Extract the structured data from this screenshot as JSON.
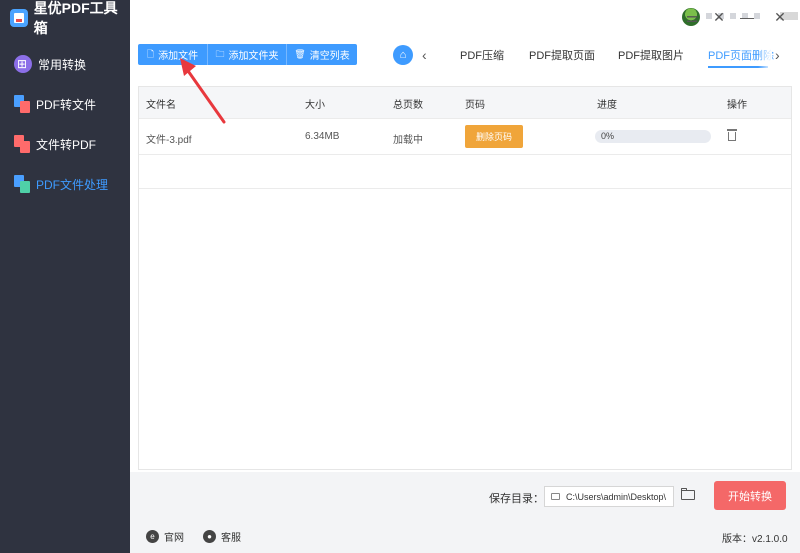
{
  "app": {
    "title": "星优PDF工具箱"
  },
  "sidebar": {
    "items": [
      {
        "label": "常用转换",
        "icon": "grid-icon",
        "active": false
      },
      {
        "label": "PDF转文件",
        "icon": "pdf-to-file-icon",
        "active": false
      },
      {
        "label": "文件转PDF",
        "icon": "file-to-pdf-icon",
        "active": false
      },
      {
        "label": "PDF文件处理",
        "icon": "pdf-process-icon",
        "active": true
      }
    ]
  },
  "titlebar": {
    "controls": [
      "settings-icon",
      "close-x-icon",
      "minimize-icon",
      "maximize-icon",
      "close-icon"
    ]
  },
  "toolbar": {
    "add_file": "添加文件",
    "add_folder": "添加文件夹",
    "clear_list": "清空列表"
  },
  "tabs": {
    "items": [
      "PDF压缩",
      "PDF提取页面",
      "PDF提取图片",
      "PDF页面删除"
    ],
    "active_index": 3
  },
  "table": {
    "headers": [
      "文件名",
      "大小",
      "总页数",
      "页码",
      "进度",
      "操作"
    ],
    "rows": [
      {
        "filename": "文件-3.pdf",
        "size": "6.34MB",
        "pages": "加载中",
        "action_label": "删除页码",
        "progress_text": "0%",
        "progress": 0
      }
    ]
  },
  "output": {
    "label": "保存目录：",
    "path": "C:\\Users\\admin\\Desktop\\",
    "start_label": "开始转换"
  },
  "footer": {
    "website": "官网",
    "support": "客服",
    "version": "版本：v2.1.0.0"
  },
  "colors": {
    "accent": "#3e9bff",
    "sidebar_bg": "#2f3340",
    "delete_button": "#f0a53a",
    "start_button": "#f46868",
    "annotation_arrow": "#e8383d"
  }
}
